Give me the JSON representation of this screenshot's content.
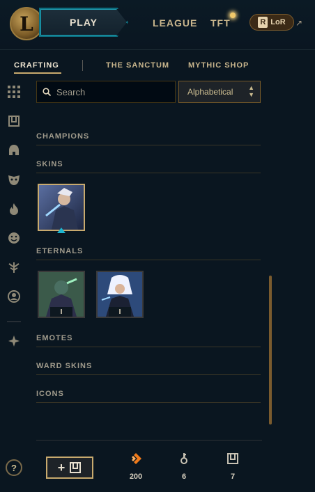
{
  "topbar": {
    "logo_letter": "L",
    "play_label": "PLAY",
    "modes": [
      "LEAGUE",
      "TFT"
    ],
    "lor_label": "LoR",
    "lor_badge": "R"
  },
  "subnav": {
    "tabs": [
      {
        "label": "CRAFTING",
        "active": true
      },
      {
        "label": "THE SANCTUM",
        "active": false
      },
      {
        "label": "MYTHIC SHOP",
        "active": false
      }
    ]
  },
  "sidebar": {
    "icons": [
      "grid-icon",
      "chest-icon",
      "helmet-icon",
      "mask-icon",
      "flame-icon",
      "emote-icon",
      "ward-icon",
      "profile-icon",
      "companion-icon"
    ]
  },
  "filters": {
    "search_placeholder": "Search",
    "sort_value": "Alphabetical"
  },
  "sections": {
    "champions": "CHAMPIONS",
    "skins": "SKINS",
    "eternals": "ETERNALS",
    "emotes": "EMOTES",
    "ward_skins": "WARD SKINS",
    "icons": "ICONS"
  },
  "eternals": [
    {
      "count": "I"
    },
    {
      "count": "I"
    }
  ],
  "bottom": {
    "help": "?",
    "add_plus": "+",
    "currencies": [
      {
        "icon": "orange-essence-icon",
        "value": "200"
      },
      {
        "icon": "key-icon",
        "value": "6"
      },
      {
        "icon": "chest-icon",
        "value": "7"
      }
    ]
  },
  "colors": {
    "accent_gold": "#c8aa6e",
    "play_cyan": "#1fa0b4",
    "background": "#0a1620"
  }
}
